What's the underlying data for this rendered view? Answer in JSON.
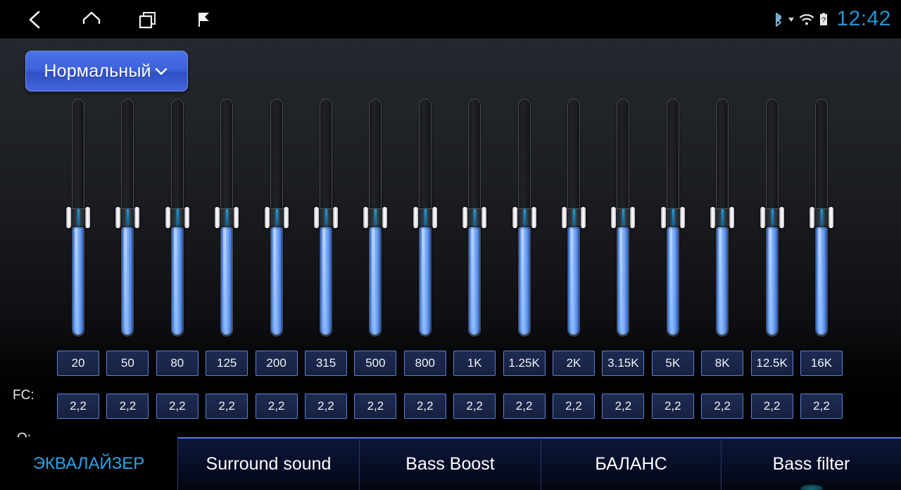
{
  "statusbar": {
    "nav": [
      {
        "name": "back-icon",
        "glyph": "back"
      },
      {
        "name": "home-icon",
        "glyph": "home"
      },
      {
        "name": "recents-icon",
        "glyph": "recents"
      },
      {
        "name": "flag-icon",
        "glyph": "flag"
      }
    ],
    "icons": [
      {
        "name": "bluetooth-icon"
      },
      {
        "name": "signal-triangle-icon"
      },
      {
        "name": "wifi-icon"
      },
      {
        "name": "battery-unknown-icon",
        "label": "?"
      }
    ],
    "clock": "12:42",
    "clock_color": "#2196d6"
  },
  "preset": {
    "label": "Нормальный",
    "chevron": "chevron-down",
    "accent": "#4a74e8"
  },
  "equalizer": {
    "fc_label": "FC:",
    "q_label": "Q:",
    "bands": [
      {
        "fc": "20",
        "q": "2,2",
        "gain_pct": 50
      },
      {
        "fc": "50",
        "q": "2,2",
        "gain_pct": 50
      },
      {
        "fc": "80",
        "q": "2,2",
        "gain_pct": 50
      },
      {
        "fc": "125",
        "q": "2,2",
        "gain_pct": 50
      },
      {
        "fc": "200",
        "q": "2,2",
        "gain_pct": 50
      },
      {
        "fc": "315",
        "q": "2,2",
        "gain_pct": 50
      },
      {
        "fc": "500",
        "q": "2,2",
        "gain_pct": 50
      },
      {
        "fc": "800",
        "q": "2,2",
        "gain_pct": 50
      },
      {
        "fc": "1K",
        "q": "2,2",
        "gain_pct": 50
      },
      {
        "fc": "1.25K",
        "q": "2,2",
        "gain_pct": 50
      },
      {
        "fc": "2K",
        "q": "2,2",
        "gain_pct": 50
      },
      {
        "fc": "3.15K",
        "q": "2,2",
        "gain_pct": 50
      },
      {
        "fc": "5K",
        "q": "2,2",
        "gain_pct": 50
      },
      {
        "fc": "8K",
        "q": "2,2",
        "gain_pct": 50
      },
      {
        "fc": "12.5K",
        "q": "2,2",
        "gain_pct": 50
      },
      {
        "fc": "16K",
        "q": "2,2",
        "gain_pct": 50
      }
    ]
  },
  "tabs": [
    {
      "label": "ЭКВАЛАЙЗЕР",
      "active": true
    },
    {
      "label": "Surround sound",
      "active": false
    },
    {
      "label": "Bass Boost",
      "active": false
    },
    {
      "label": "БАЛАНС",
      "active": false
    },
    {
      "label": "Bass filter",
      "active": false
    }
  ]
}
